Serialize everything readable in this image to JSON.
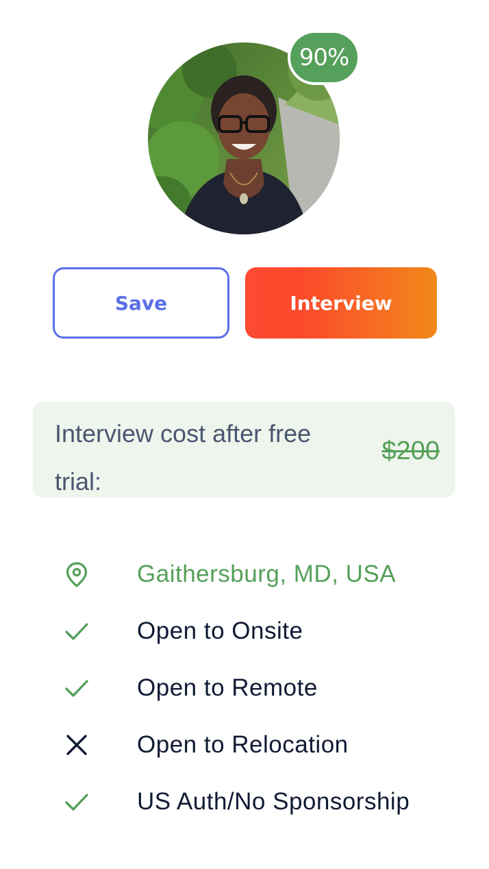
{
  "profile": {
    "match_percent": "90%",
    "photo": "candidate-photo"
  },
  "actions": {
    "save_label": "Save",
    "interview_label": "Interview"
  },
  "cost": {
    "label": "Interview cost after free trial:",
    "price": "$200"
  },
  "attributes": [
    {
      "icon": "location-pin-icon",
      "text": "Gaithersburg, MD, USA",
      "status": "location"
    },
    {
      "icon": "check-icon",
      "text": "Open to Onsite",
      "status": "yes"
    },
    {
      "icon": "check-icon",
      "text": "Open to Remote",
      "status": "yes"
    },
    {
      "icon": "close-icon",
      "text": "Open to Relocation",
      "status": "no"
    },
    {
      "icon": "check-icon",
      "text": "US Auth/No Sponsorship",
      "status": "yes"
    }
  ],
  "colors": {
    "green": "#55a05a",
    "blue": "#5b6ee8",
    "orange_start": "#fd4a33",
    "orange_end": "#f08a1a",
    "text_dark": "#111a33",
    "cost_bg": "#eef5ec"
  }
}
